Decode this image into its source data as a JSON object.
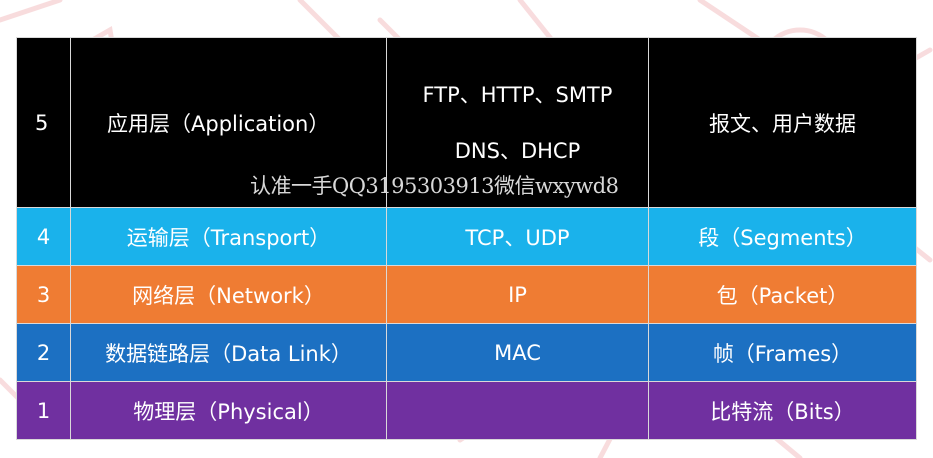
{
  "colors": {
    "application": "#000000",
    "transport": "#1ab2eb",
    "network": "#ef7c33",
    "data_link": "#1c70c2",
    "physical": "#7030a0",
    "watermark": "#e3232c"
  },
  "layers": [
    {
      "number": "5",
      "name": "应用层（Application）",
      "protocols": [
        "FTP、HTTP、SMTP",
        "DNS、DHCP"
      ],
      "data_unit": "报文、用户数据"
    },
    {
      "number": "4",
      "name": "运输层（Transport）",
      "protocols": [
        "TCP、UDP"
      ],
      "data_unit": "段（Segments）"
    },
    {
      "number": "3",
      "name": "网络层（Network）",
      "protocols": [
        "IP"
      ],
      "data_unit": "包（Packet）"
    },
    {
      "number": "2",
      "name": "数据链路层（Data Link）",
      "protocols": [
        "MAC"
      ],
      "data_unit": "帧（Frames）"
    },
    {
      "number": "1",
      "name": "物理层（Physical）",
      "protocols": [
        ""
      ],
      "data_unit": "比特流（Bits）"
    }
  ],
  "overlay_text": "认准一手QQ3195303913微信wxywd8"
}
